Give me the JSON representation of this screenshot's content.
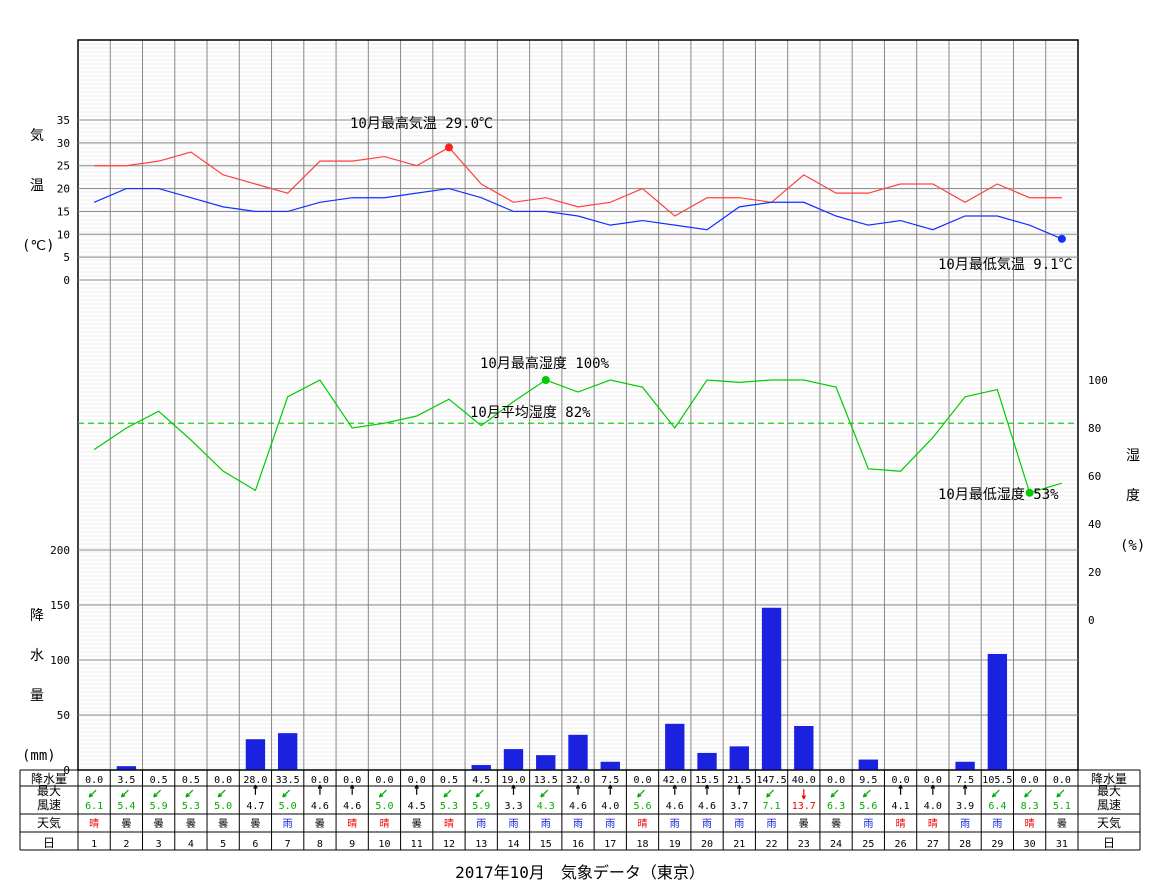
{
  "title": "2017年10月　気象データ（東京）",
  "axes": {
    "temp": {
      "label_1": "気",
      "label_2": "温",
      "unit": "(℃)",
      "ticks": [
        0,
        5,
        10,
        15,
        20,
        25,
        30,
        35
      ]
    },
    "hum": {
      "label_1": "湿",
      "label_2": "度",
      "unit": "(%)",
      "ticks": [
        0,
        20,
        40,
        60,
        80,
        100
      ]
    },
    "rain": {
      "label_1": "降",
      "label_2": "水",
      "label_3": "量",
      "unit": "(mm)",
      "ticks": [
        0,
        50,
        100,
        150,
        200
      ]
    }
  },
  "rows": {
    "rain": {
      "label": "降水量"
    },
    "wind": {
      "label1": "最大",
      "label2": "風速"
    },
    "weather": {
      "label": "天気"
    },
    "day": {
      "label": "日"
    }
  },
  "annotations": {
    "max_temp": "10月最高気温 29.0℃",
    "min_temp": "10月最低気温 9.1℃",
    "max_hum": "10月最高湿度 100%",
    "avg_hum": "10月平均湿度 82%",
    "min_hum": "10月最低湿度 53%"
  },
  "chart_data": {
    "type": "multi",
    "days": [
      1,
      2,
      3,
      4,
      5,
      6,
      7,
      8,
      9,
      10,
      11,
      12,
      13,
      14,
      15,
      16,
      17,
      18,
      19,
      20,
      21,
      22,
      23,
      24,
      25,
      26,
      27,
      28,
      29,
      30,
      31
    ],
    "temp_high": [
      25,
      25,
      26,
      28,
      23,
      21,
      19,
      26,
      26,
      27,
      25,
      29,
      21,
      17,
      18,
      16,
      17,
      20,
      14,
      18,
      18,
      17,
      23,
      19,
      19,
      21,
      21,
      17,
      21,
      18,
      18
    ],
    "temp_low": [
      17,
      20,
      20,
      18,
      16,
      15,
      15,
      17,
      18,
      18,
      19,
      20,
      18,
      15,
      15,
      14,
      12,
      13,
      12,
      11,
      16,
      17,
      17,
      14,
      12,
      13,
      11,
      14,
      14,
      12,
      9
    ],
    "humidity_max": [
      71,
      80,
      87,
      75,
      62,
      54,
      93,
      100,
      80,
      82,
      85,
      92,
      81,
      91,
      100,
      95,
      100,
      97,
      80,
      100,
      99,
      100,
      100,
      97,
      63,
      62,
      76,
      93,
      96,
      53,
      57
    ],
    "humidity_avg": 82,
    "rain_mm": [
      0.0,
      3.5,
      0.5,
      0.5,
      0.0,
      28.0,
      33.5,
      0.0,
      0.0,
      0.0,
      0.0,
      0.5,
      4.5,
      19.0,
      13.5,
      32.0,
      7.5,
      0.0,
      42.0,
      15.5,
      21.5,
      147.5,
      40.0,
      0.0,
      9.5,
      0.0,
      0.0,
      7.5,
      105.5,
      0.0,
      0.0
    ],
    "wind_speed": [
      6.1,
      5.4,
      5.9,
      5.3,
      5.0,
      4.7,
      5.0,
      4.6,
      4.6,
      5.0,
      4.5,
      5.3,
      5.9,
      3.3,
      4.3,
      4.6,
      4.0,
      5.6,
      4.6,
      4.6,
      3.7,
      7.1,
      13.7,
      6.3,
      5.6,
      4.1,
      4.0,
      3.9,
      6.4,
      8.3,
      5.1
    ],
    "wind_dir": [
      "SW",
      "SW",
      "SW",
      "SW",
      "SW",
      "N",
      "SW",
      "N",
      "N",
      "SW",
      "N",
      "SW",
      "SW",
      "N",
      "SW",
      "N",
      "N",
      "SW",
      "N",
      "N",
      "N",
      "SW",
      "S",
      "SW",
      "SW",
      "N",
      "N",
      "N",
      "SW",
      "SW",
      "SW"
    ],
    "wind_color": [
      "g",
      "g",
      "g",
      "g",
      "g",
      "k",
      "g",
      "k",
      "k",
      "g",
      "k",
      "g",
      "g",
      "k",
      "g",
      "k",
      "k",
      "g",
      "k",
      "k",
      "k",
      "g",
      "r",
      "g",
      "g",
      "k",
      "k",
      "k",
      "g",
      "g",
      "g"
    ],
    "weather": [
      "晴",
      "曇",
      "曇",
      "曇",
      "曇",
      "曇",
      "雨",
      "曇",
      "晴",
      "晴",
      "曇",
      "晴",
      "雨",
      "雨",
      "雨",
      "雨",
      "雨",
      "晴",
      "雨",
      "雨",
      "雨",
      "雨",
      "曇",
      "曇",
      "雨",
      "晴",
      "晴",
      "雨",
      "雨",
      "晴",
      "曇"
    ]
  }
}
